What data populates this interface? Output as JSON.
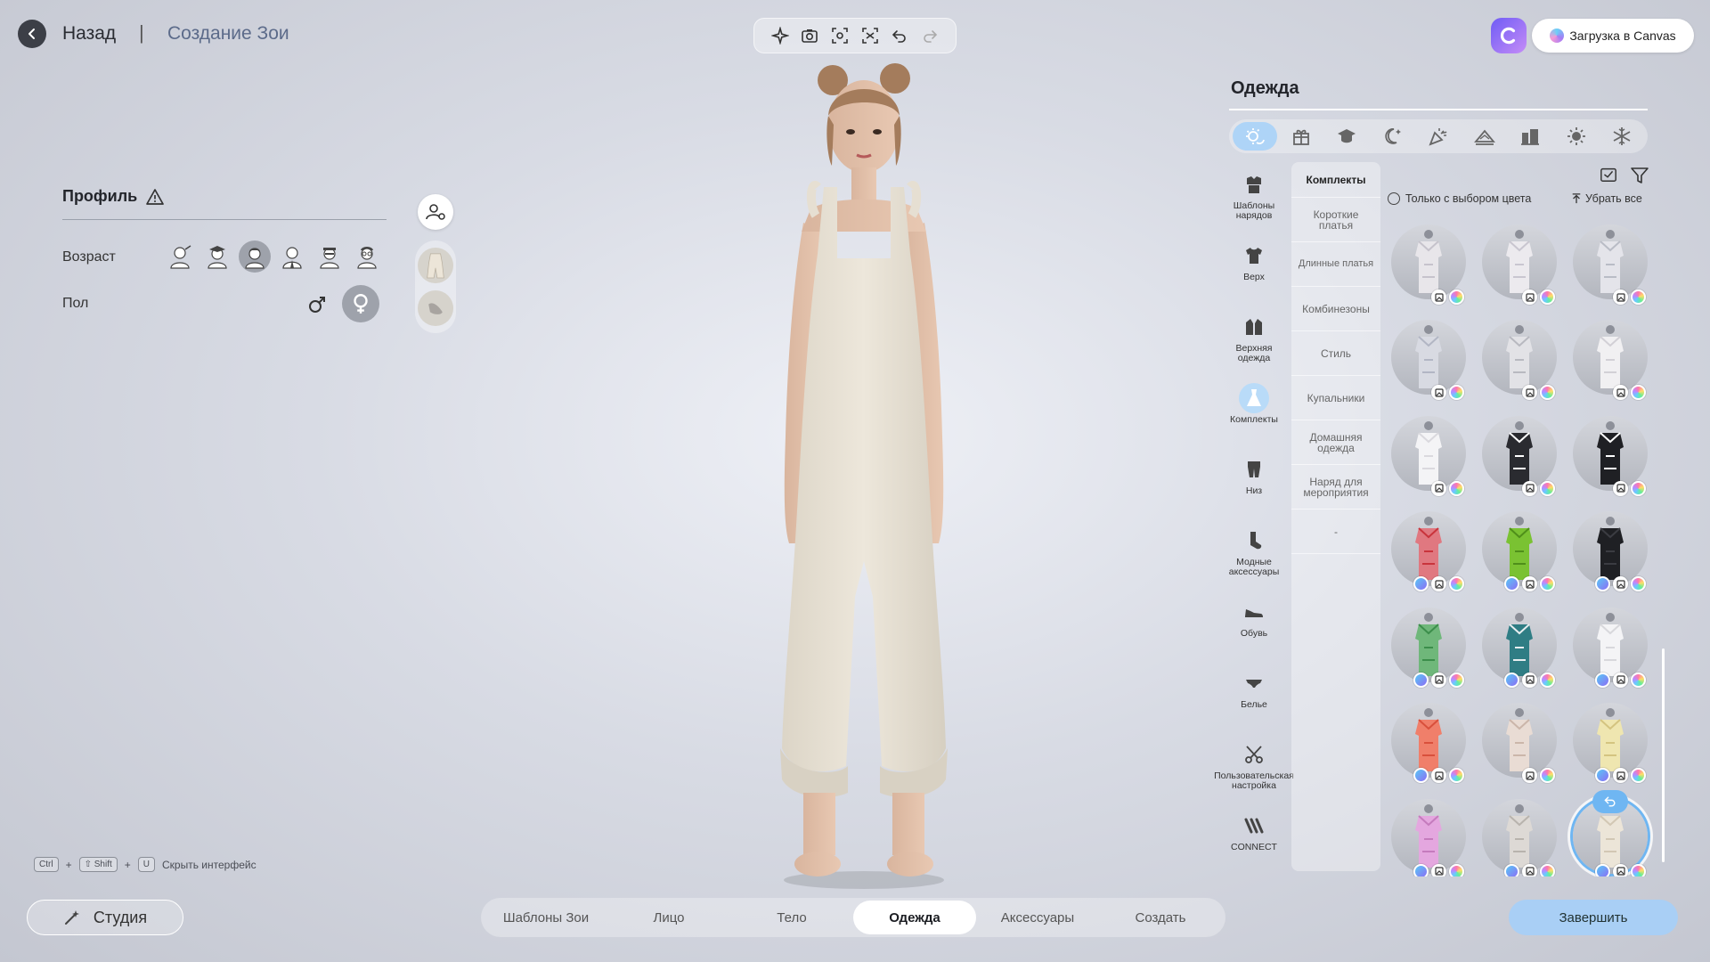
{
  "header": {
    "back_label": "Назад",
    "separator": "|",
    "page_title": "Создание Зои"
  },
  "toolbar": {
    "icons": [
      "sparkle-icon",
      "camera-icon",
      "focus-frame-icon",
      "face-frame-icon",
      "undo-icon",
      "redo-icon"
    ]
  },
  "canvas": {
    "upload_label": "Загрузка в Canvas"
  },
  "profile": {
    "title": "Профиль",
    "age_label": "Возраст",
    "gender_label": "Пол",
    "age_options": [
      "baby",
      "child",
      "teen",
      "adult",
      "middle-aged",
      "elder"
    ],
    "selected_age_index": 2,
    "gender_options": [
      "male",
      "female"
    ],
    "selected_gender": "female"
  },
  "shortcut": {
    "key1": "Ctrl",
    "plus1": "+",
    "key2": "⇧ Shift",
    "plus2": "+",
    "key3": "U",
    "label": "Скрыть интерфейс"
  },
  "studio": {
    "label": "Студия"
  },
  "bottom_tabs": [
    {
      "label": "Шаблоны Зои"
    },
    {
      "label": "Лицо"
    },
    {
      "label": "Тело"
    },
    {
      "label": "Одежда"
    },
    {
      "label": "Аксессуары"
    },
    {
      "label": "Создать"
    }
  ],
  "active_tab_index": 3,
  "finish_label": "Завершить",
  "panel": {
    "title": "Одежда",
    "theme_icons": [
      "day-night-icon",
      "gift-icon",
      "graduation-cap-icon",
      "moon-icon",
      "party-icon",
      "ski-slope-icon",
      "city-icon",
      "sun-icon",
      "snowflake-icon"
    ],
    "categories": [
      {
        "label": "Шаблоны нарядов",
        "icon": "outfit-template-icon"
      },
      {
        "label": "Верх",
        "icon": "tshirt-icon"
      },
      {
        "label": "Верхняя одежда",
        "icon": "jacket-icon"
      },
      {
        "label": "Комплекты",
        "icon": "dress-icon"
      },
      {
        "label": "Низ",
        "icon": "pants-icon"
      },
      {
        "label": "Модные аксессуары",
        "icon": "sock-icon"
      },
      {
        "label": "Обувь",
        "icon": "shoe-icon"
      },
      {
        "label": "Белье",
        "icon": "underwear-icon"
      },
      {
        "label": "Пользовательская настройка",
        "icon": "scissors-icon"
      },
      {
        "label": "CONNECT",
        "icon": "connect-icon"
      }
    ],
    "active_category_index": 3,
    "subcategories": [
      {
        "label": "Комплекты"
      },
      {
        "label": "Короткие платья"
      },
      {
        "label": "Длинные платья"
      },
      {
        "label": "Комбинезоны"
      },
      {
        "label": "Стиль"
      },
      {
        "label": "Купальники"
      },
      {
        "label": "Домашняя одежда"
      },
      {
        "label": "Наряд для мероприятия"
      },
      {
        "label": "-"
      }
    ],
    "color_only_label": "Только с выбором цвета",
    "remove_all_label": "Убрать все",
    "items": [
      {
        "color": "#e8e6ea",
        "accent": "#c6c3cc",
        "ai": false
      },
      {
        "color": "#eceaee",
        "accent": "#c9c6d0",
        "ai": false
      },
      {
        "color": "#e4e4ea",
        "accent": "#b9bcc6",
        "ai": false
      },
      {
        "color": "#d8dae2",
        "accent": "#b2b6c4",
        "ai": false
      },
      {
        "color": "#e2e2e6",
        "accent": "#b8b9c0",
        "ai": false
      },
      {
        "color": "#f1f0f2",
        "accent": "#d2d0d6",
        "ai": false
      },
      {
        "color": "#f4f4f6",
        "accent": "#dad9de",
        "ai": false
      },
      {
        "color": "#2a2b30",
        "accent": "#ffffff",
        "ai": false
      },
      {
        "color": "#1f2024",
        "accent": "#ffffff",
        "ai": false
      },
      {
        "color": "#e07880",
        "accent": "#c9343c",
        "ai": true
      },
      {
        "color": "#7ac232",
        "accent": "#4f8f1a",
        "ai": true
      },
      {
        "color": "#1f2024",
        "accent": "#3b3c42",
        "ai": true
      },
      {
        "color": "#6fb77a",
        "accent": "#3c8e4b",
        "ai": true
      },
      {
        "color": "#2f7d84",
        "accent": "#e8eef0",
        "ai": true
      },
      {
        "color": "#f4f4f6",
        "accent": "#d8d8dc",
        "ai": true
      },
      {
        "color": "#f07f6a",
        "accent": "#d9503c",
        "ai": true
      },
      {
        "color": "#e9dcd4",
        "accent": "#cbb6aa",
        "ai": false
      },
      {
        "color": "#efe6b0",
        "accent": "#d4c480",
        "ai": true
      },
      {
        "color": "#e4a7df",
        "accent": "#c57bbd",
        "ai": true
      },
      {
        "color": "#ddd9d5",
        "accent": "#b8b3ad",
        "ai": true
      },
      {
        "color": "#ece5d8",
        "accent": "#d2c7b4",
        "ai": true
      }
    ],
    "selected_item_index": 20
  },
  "colors": {
    "accent": "#6fb6f2",
    "finish_button": "#a9cff5",
    "garment_main": "#ebe5d8"
  }
}
